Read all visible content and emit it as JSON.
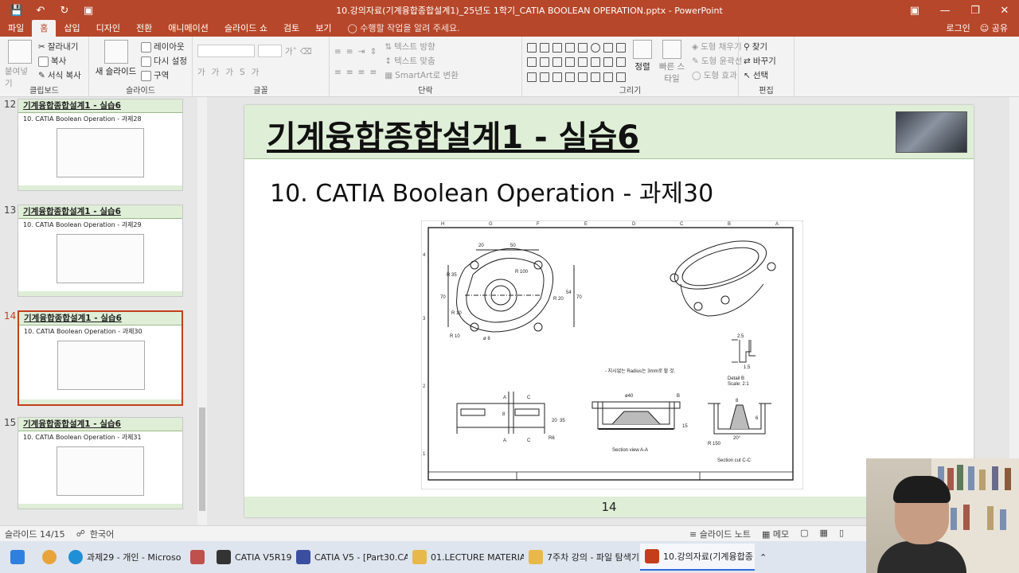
{
  "window": {
    "title": "10.강의자료(기계융합종합설계1)_25년도 1학기_CATIA BOOLEAN OPERATION.pptx - PowerPoint",
    "quick_access": [
      "save-icon",
      "undo-icon",
      "redo-icon",
      "present-icon"
    ],
    "controls": [
      "ribbon-display-icon",
      "minimize-icon",
      "restore-icon",
      "close-icon"
    ]
  },
  "tabs": {
    "items": [
      "파일",
      "홈",
      "삽입",
      "디자인",
      "전환",
      "애니메이션",
      "슬라이드 쇼",
      "검토",
      "보기"
    ],
    "active": "홈",
    "tell_me": "수행할 작업을 알려 주세요.",
    "login": "로그인",
    "share": "공유"
  },
  "ribbon": {
    "clipboard": {
      "paste": "붙여넣기",
      "cut": "잘라내기",
      "copy": "복사",
      "format_painter": "서식 복사",
      "label": "클립보드"
    },
    "slides": {
      "new_slide": "새 슬라이드",
      "layout": "레이아웃",
      "reset": "다시 설정",
      "section": "구역",
      "label": "슬라이드"
    },
    "font": {
      "label": "글꼴"
    },
    "paragraph": {
      "text_direction": "텍스트 방향",
      "align_text": "텍스트 맞춤",
      "smartart": "SmartArt로 변환",
      "label": "단락"
    },
    "drawing": {
      "arrange": "정렬",
      "quick_styles": "빠른 스타일",
      "fill": "도형 채우기",
      "outline": "도형 윤곽선",
      "effects": "도형 효과",
      "label": "그리기"
    },
    "editing": {
      "find": "찾기",
      "replace": "바꾸기",
      "select": "선택",
      "label": "편집"
    }
  },
  "thumbnails": [
    {
      "num": "12",
      "title": "기계융합종합설계1 - 실습6",
      "subtitle": "10. CATIA Boolean Operation - 과제28",
      "selected": false
    },
    {
      "num": "13",
      "title": "기계융합종합설계1 - 실습6",
      "subtitle": "10. CATIA Boolean Operation - 과제29",
      "selected": false
    },
    {
      "num": "14",
      "title": "기계융합종합설계1 - 실습6",
      "subtitle": "10. CATIA Boolean Operation - 과제30",
      "selected": true
    },
    {
      "num": "15",
      "title": "기계융합종합설계1 - 실습6",
      "subtitle": "10. CATIA Boolean Operation - 과제31",
      "selected": false
    }
  ],
  "slide": {
    "title": "기계융합종합설계1 - 실습6",
    "subtitle": "10. CATIA Boolean Operation - 과제30",
    "page_number": "14",
    "drawing": {
      "dims": [
        "20",
        "50",
        "70",
        "70",
        "54",
        "R 35",
        "R 100",
        "R 20",
        "R 10",
        "R 10",
        "ø 8",
        "ø40",
        "35",
        "20",
        "15",
        "8",
        "8",
        "6",
        "1.5",
        "2.5",
        "20°",
        "R 150",
        "R6"
      ],
      "note": "- 지시없는 Radius는 3mm로 할 것.",
      "section_aa": "Section view A-A",
      "section_cc": "Section cut C-C",
      "detail": "Detail B",
      "scale": "Scale:  2:1",
      "col_labels": [
        "H",
        "G",
        "F",
        "E",
        "D",
        "C",
        "B",
        "A"
      ],
      "row_labels": [
        "4",
        "3",
        "2",
        "1"
      ],
      "markers": [
        "A",
        "A",
        "C",
        "C",
        "B"
      ]
    }
  },
  "status": {
    "slide_info": "슬라이드 14/15",
    "language": "한국어",
    "notes": "슬라이드 노트",
    "comments": "메모"
  },
  "taskbar": [
    {
      "label": "",
      "icon": "windows-start-icon",
      "color": "#2f7fe0"
    },
    {
      "label": "",
      "icon": "chrome-icon",
      "color": "#e8a33a"
    },
    {
      "label": "과제29 - 개인 - Microso",
      "icon": "edge-icon",
      "color": "#1f8fd6"
    },
    {
      "label": "",
      "icon": "app-icon",
      "color": "#c0504d"
    },
    {
      "label": "CATIA V5R19",
      "icon": "terminal-icon",
      "color": "#333333"
    },
    {
      "label": "CATIA V5 - [Part30.CATF",
      "icon": "catia-icon",
      "color": "#3a4fa0"
    },
    {
      "label": "01.LECTURE MATERIAL -",
      "icon": "folder-icon",
      "color": "#e8b84a"
    },
    {
      "label": "7주차 강의 - 파일 탐색기",
      "icon": "folder-icon",
      "color": "#e8b84a"
    },
    {
      "label": "10.강의자료(기계융합종",
      "icon": "powerpoint-icon",
      "color": "#c43e1c",
      "active": true
    }
  ]
}
